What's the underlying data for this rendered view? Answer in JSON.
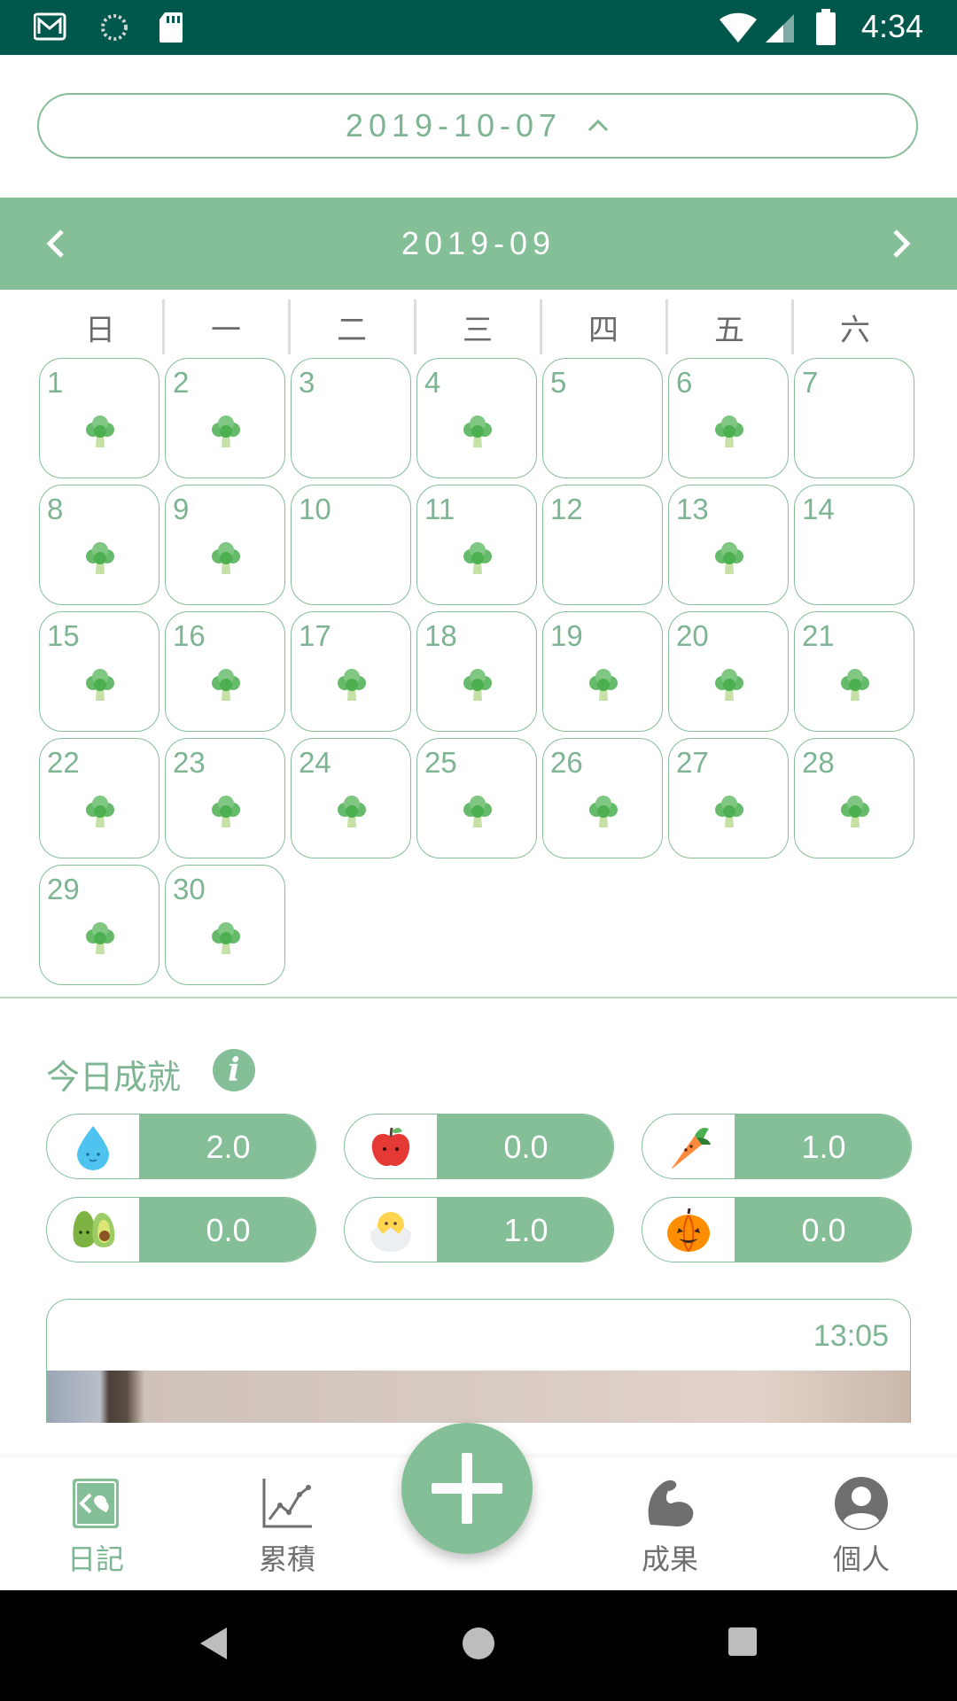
{
  "status_bar": {
    "time": "4:34"
  },
  "selected_date": "2019-10-07",
  "calendar": {
    "month": "2019-09",
    "weekdays": [
      "日",
      "一",
      "二",
      "三",
      "四",
      "五",
      "六"
    ],
    "days": [
      {
        "n": "1",
        "b": true
      },
      {
        "n": "2",
        "b": true
      },
      {
        "n": "3",
        "b": false
      },
      {
        "n": "4",
        "b": true
      },
      {
        "n": "5",
        "b": false
      },
      {
        "n": "6",
        "b": true
      },
      {
        "n": "7",
        "b": false
      },
      {
        "n": "8",
        "b": true
      },
      {
        "n": "9",
        "b": true
      },
      {
        "n": "10",
        "b": false
      },
      {
        "n": "11",
        "b": true
      },
      {
        "n": "12",
        "b": false
      },
      {
        "n": "13",
        "b": true
      },
      {
        "n": "14",
        "b": false
      },
      {
        "n": "15",
        "b": true
      },
      {
        "n": "16",
        "b": true
      },
      {
        "n": "17",
        "b": true
      },
      {
        "n": "18",
        "b": true
      },
      {
        "n": "19",
        "b": true
      },
      {
        "n": "20",
        "b": true
      },
      {
        "n": "21",
        "b": true
      },
      {
        "n": "22",
        "b": true
      },
      {
        "n": "23",
        "b": true
      },
      {
        "n": "24",
        "b": true
      },
      {
        "n": "25",
        "b": true
      },
      {
        "n": "26",
        "b": true
      },
      {
        "n": "27",
        "b": true
      },
      {
        "n": "28",
        "b": true
      },
      {
        "n": "29",
        "b": true
      },
      {
        "n": "30",
        "b": true
      }
    ]
  },
  "achievements": {
    "title": "今日成就",
    "items": [
      {
        "icon": "water-drop-icon",
        "value": "2.0"
      },
      {
        "icon": "apple-icon",
        "value": "0.0"
      },
      {
        "icon": "carrot-icon",
        "value": "1.0"
      },
      {
        "icon": "avocado-icon",
        "value": "0.0"
      },
      {
        "icon": "chick-egg-icon",
        "value": "1.0"
      },
      {
        "icon": "pumpkin-icon",
        "value": "0.0"
      }
    ]
  },
  "entry": {
    "time": "13:05"
  },
  "bottom_nav": {
    "diary": "日記",
    "accumulate": "累積",
    "results": "成果",
    "personal": "個人"
  },
  "colors": {
    "accent": "#84bf97",
    "status_bar": "#00574b",
    "text_green": "#7db492"
  }
}
